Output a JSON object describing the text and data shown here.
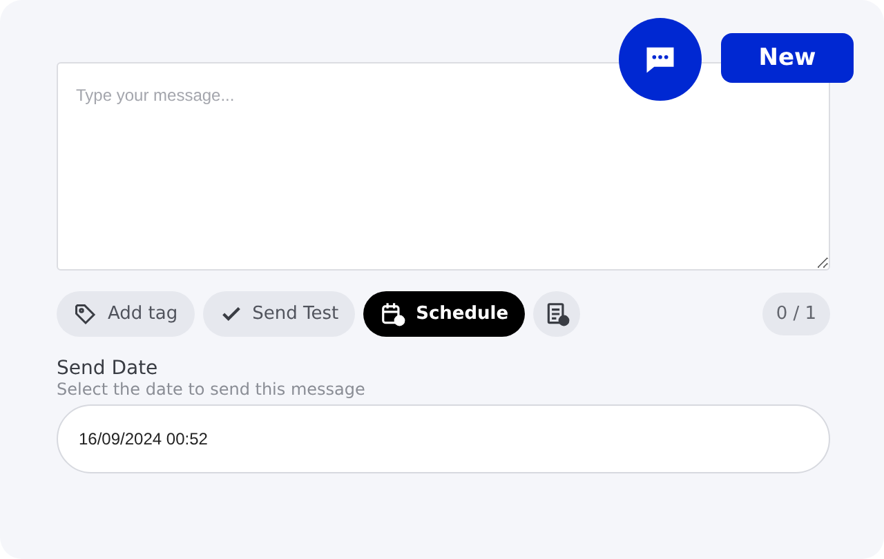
{
  "new_button": "New",
  "message": {
    "placeholder": "Type your message..."
  },
  "toolbar": [
    {
      "kind": "tag",
      "label": "Add tag",
      "selected": false
    },
    {
      "kind": "check",
      "label": "Send Test",
      "selected": false
    },
    {
      "kind": "schedule",
      "label": "Schedule",
      "selected": true
    },
    {
      "kind": "report",
      "selected": false
    }
  ],
  "counter": "0 / 1",
  "send_date": {
    "label": "Send Date",
    "hint": "Select the date to send this message",
    "value": "16/09/2024 00:52"
  }
}
